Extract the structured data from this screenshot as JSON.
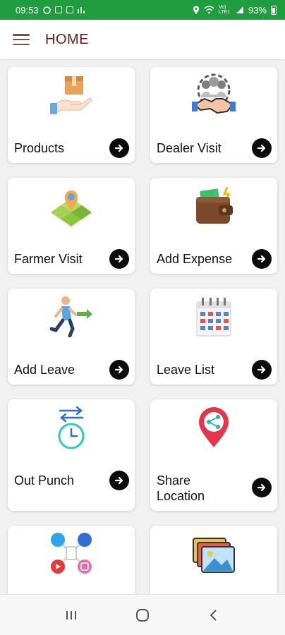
{
  "status_bar": {
    "time": "09:53",
    "battery": "93%",
    "network_text": "Vo) LTE1",
    "icons": [
      "whatsapp-icon",
      "image-icon",
      "message-icon",
      "location-icon",
      "wifi-icon",
      "signal-icon",
      "battery-icon"
    ]
  },
  "app_bar": {
    "title": "HOME",
    "menu_icon": "hamburger-menu-icon"
  },
  "menu": [
    {
      "id": "products",
      "label": "Products",
      "icon": "box-in-hand-icon"
    },
    {
      "id": "dealer-visit",
      "label": "Dealer Visit",
      "icon": "handshake-group-icon"
    },
    {
      "id": "farmer-visit",
      "label": "Farmer Visit",
      "icon": "map-pin-field-icon"
    },
    {
      "id": "add-expense",
      "label": "Add Expense",
      "icon": "wallet-icon"
    },
    {
      "id": "add-leave",
      "label": "Add Leave",
      "icon": "running-man-icon"
    },
    {
      "id": "leave-list",
      "label": "Leave List",
      "icon": "calendar-icon"
    },
    {
      "id": "out-punch",
      "label": "Out Punch",
      "icon": "clock-arrows-icon"
    },
    {
      "id": "share-location",
      "label": "Share Location",
      "icon": "share-location-pin-icon"
    },
    {
      "id": "social",
      "label": "",
      "icon": "social-media-icons"
    },
    {
      "id": "gallery",
      "label": "",
      "icon": "photo-gallery-icon"
    }
  ],
  "colors": {
    "status_bar": "#1f9d3f",
    "title": "#6b1a1a",
    "arrow_bg": "#0b0b0b",
    "background": "#f1f1f1"
  },
  "nav_bar": [
    "recent-apps-icon",
    "home-icon",
    "back-icon"
  ]
}
